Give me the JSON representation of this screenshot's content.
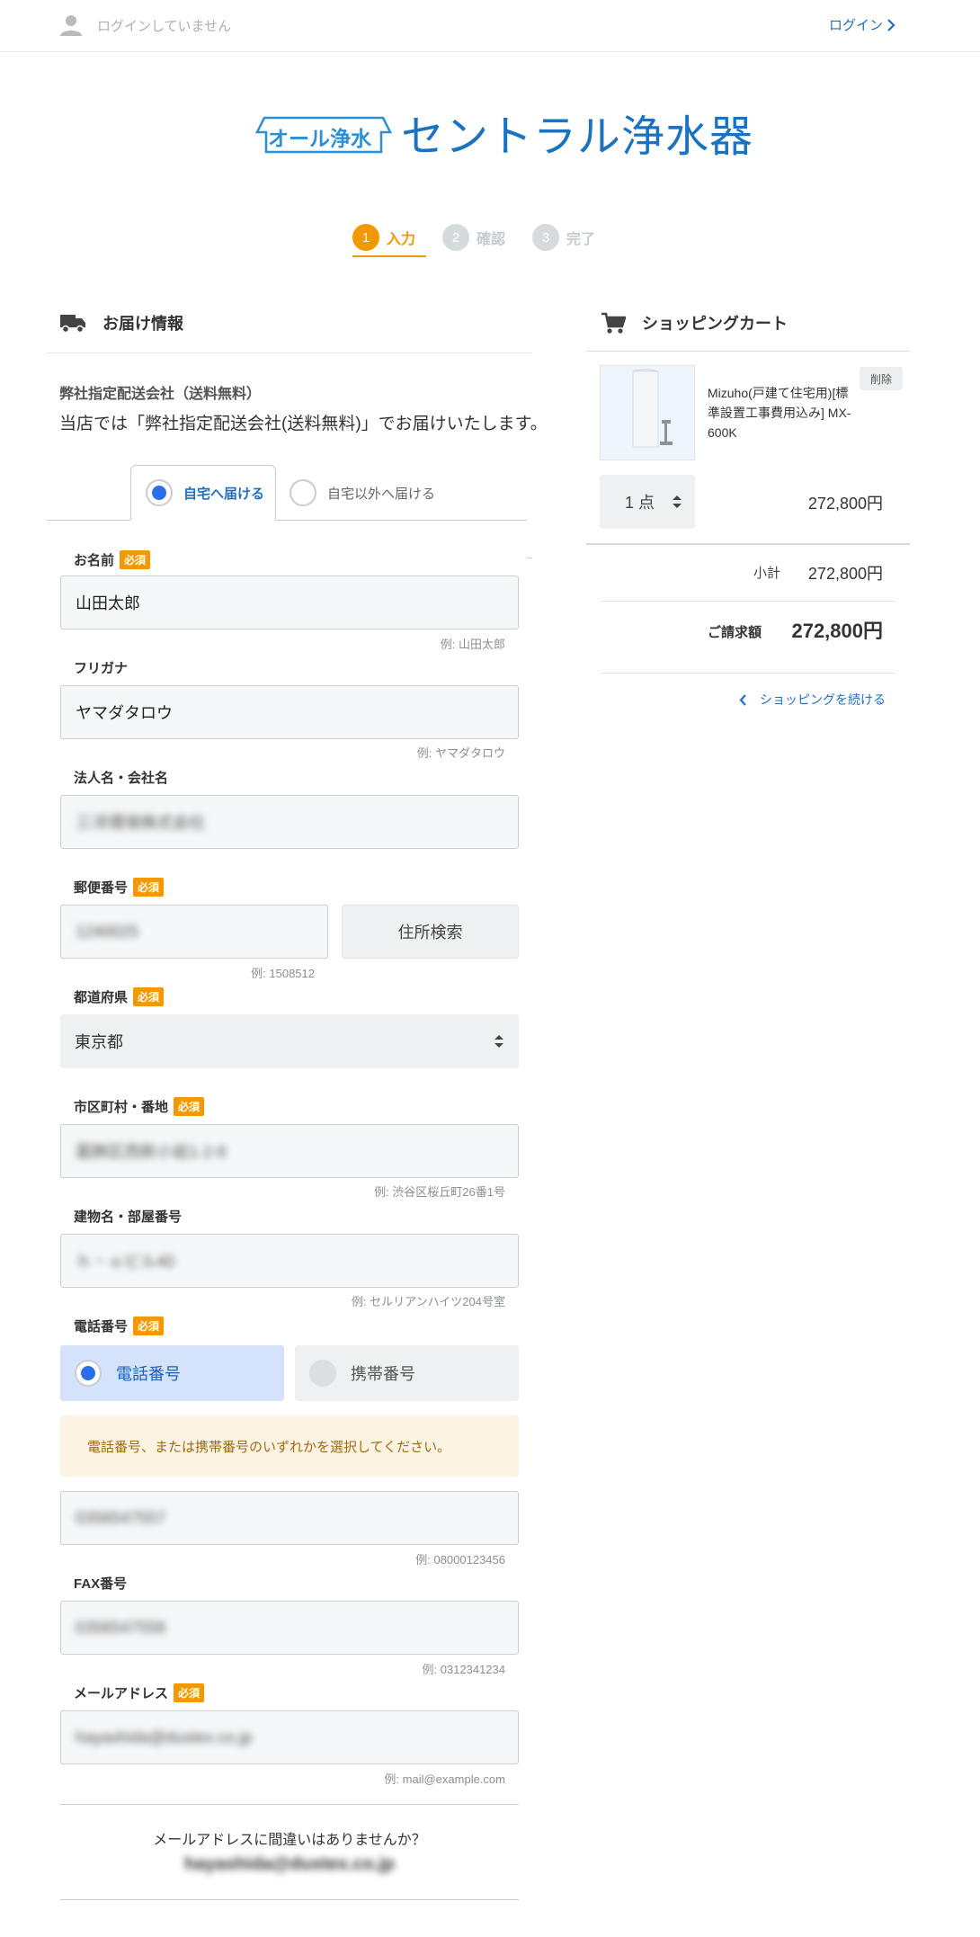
{
  "header": {
    "login_status": "ログインしていません",
    "login_link": "ログイン"
  },
  "brand": {
    "badge": "オール浄水",
    "title": "セントラル浄水器"
  },
  "steps": [
    {
      "num": "1",
      "label": "入力",
      "active": true
    },
    {
      "num": "2",
      "label": "確認",
      "active": false
    },
    {
      "num": "3",
      "label": "完了",
      "active": false
    }
  ],
  "delivery": {
    "heading": "お届け情報",
    "company": "弊社指定配送会社（送料無料）",
    "description": "当店では「弊社指定配送会社(送料無料)」でお届けいたします。",
    "tabs": [
      {
        "label": "自宅へ届ける",
        "selected": true
      },
      {
        "label": "自宅以外へ届ける",
        "selected": false
      }
    ]
  },
  "form": {
    "required": "必須",
    "name": {
      "label": "お名前",
      "value": "山田太郎",
      "hint": "例: 山田太郎"
    },
    "kana": {
      "label": "フリガナ",
      "value": "ヤマダタロウ",
      "hint": "例: ヤマダタロウ"
    },
    "company": {
      "label": "法人名・会社名",
      "value": "三洋環境株式会社"
    },
    "zip": {
      "label": "郵便番号",
      "value": "1240025",
      "hint": "例: 1508512",
      "search_button": "住所検索"
    },
    "prefecture": {
      "label": "都道府県",
      "value": "東京都"
    },
    "city": {
      "label": "市区町村・番地",
      "value": "葛飾区西新小岩1-2-6",
      "hint": "例: 渋谷区桜丘町26番1号"
    },
    "building": {
      "label": "建物名・部屋番号",
      "value": "ｈ・ｏビル40",
      "hint": "例: セルリアンハイツ204号室"
    },
    "phone": {
      "label": "電話番号",
      "options": [
        {
          "label": "電話番号",
          "selected": true
        },
        {
          "label": "携帯番号",
          "selected": false
        }
      ],
      "notice": "電話番号、または携帯番号のいずれかを選択してください。",
      "value": "0356547557",
      "hint": "例: 08000123456"
    },
    "fax": {
      "label": "FAX番号",
      "value": "0356547558",
      "hint": "例: 0312341234"
    },
    "email": {
      "label": "メールアドレス",
      "value": "hayashida@dustex.co.jp",
      "hint": "例: mail@example.com"
    },
    "confirm_question": "メールアドレスに間違いはありませんか？",
    "confirm_email": "hayashida@dustex.co.jp"
  },
  "cart": {
    "heading": "ショッピングカート",
    "item_name": "Mizuho(戸建て住宅用)[標準設置工事費用込み] MX-600K",
    "delete": "削除",
    "quantity": "1 点",
    "price": "272,800円",
    "subtotal_label": "小計",
    "subtotal": "272,800円",
    "total_label": "ご請求額",
    "total": "272,800円",
    "continue": "ショッピングを続ける"
  },
  "colors": {
    "accent": "#f39800",
    "link": "#1f6fc4",
    "brand": "#1a73c2"
  }
}
